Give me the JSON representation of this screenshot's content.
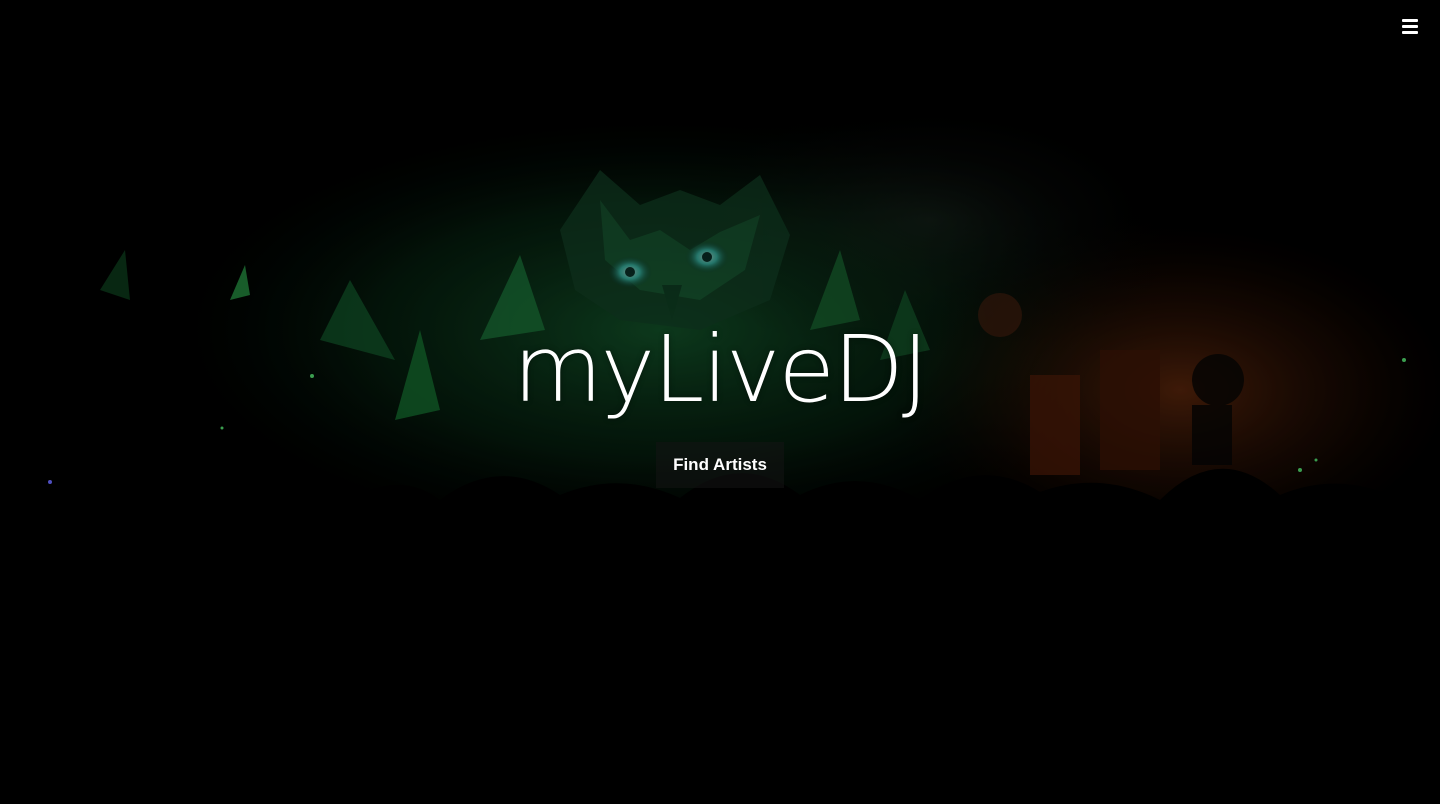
{
  "header": {
    "menu_icon": "hamburger-menu-icon"
  },
  "hero": {
    "title": "myLiveDJ",
    "cta_label": "Find Artists",
    "background": "dark concert stage photo with green owl figure"
  },
  "colors": {
    "background": "#000000",
    "text": "#ffffff",
    "accent_green": "#1fa84a",
    "accent_teal": "#3fc6b8",
    "accent_orange": "#a0451a"
  }
}
